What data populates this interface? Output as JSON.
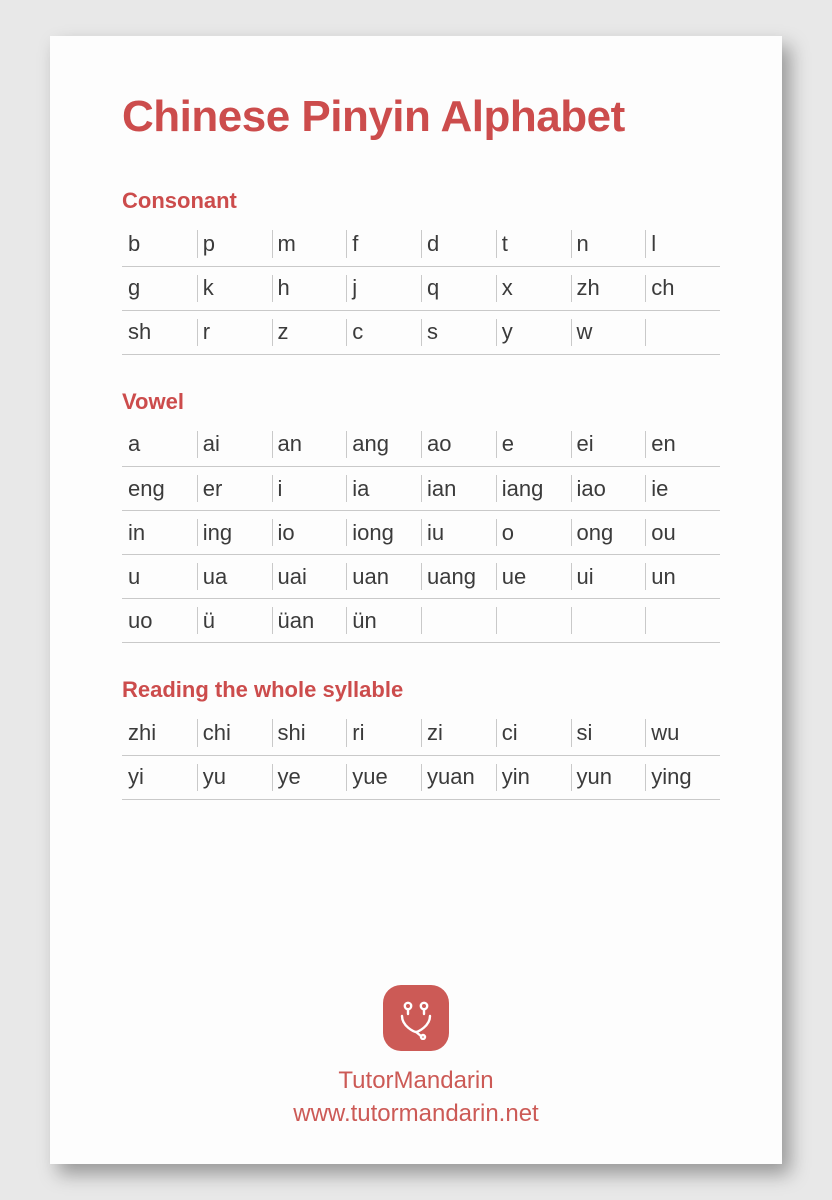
{
  "title": "Chinese Pinyin Alphabet",
  "sections": {
    "consonant": {
      "heading": "Consonant",
      "rows": [
        [
          "b",
          "p",
          "m",
          "f",
          "d",
          "t",
          "n",
          "l"
        ],
        [
          "g",
          "k",
          "h",
          "j",
          "q",
          "x",
          "zh",
          "ch"
        ],
        [
          "sh",
          "r",
          "z",
          "c",
          "s",
          "y",
          "w",
          ""
        ]
      ]
    },
    "vowel": {
      "heading": "Vowel",
      "rows": [
        [
          "a",
          "ai",
          "an",
          "ang",
          "ao",
          "e",
          "ei",
          "en"
        ],
        [
          "eng",
          "er",
          "i",
          "ia",
          "ian",
          "iang",
          "iao",
          "ie"
        ],
        [
          "in",
          "ing",
          "io",
          "iong",
          "iu",
          "o",
          "ong",
          "ou"
        ],
        [
          "u",
          "ua",
          "uai",
          "uan",
          "uang",
          "ue",
          "ui",
          "un"
        ],
        [
          "uo",
          "ü",
          "üan",
          "ün",
          "",
          "",
          "",
          ""
        ]
      ]
    },
    "syllable": {
      "heading": "Reading the whole syllable",
      "rows": [
        [
          "zhi",
          "chi",
          "shi",
          "ri",
          "zi",
          "ci",
          "si",
          "wu"
        ],
        [
          "yi",
          "yu",
          "ye",
          "yue",
          "yuan",
          "yin",
          "yun",
          "ying"
        ]
      ]
    }
  },
  "footer": {
    "brand": "TutorMandarin",
    "url": "www.tutormandarin.net"
  }
}
